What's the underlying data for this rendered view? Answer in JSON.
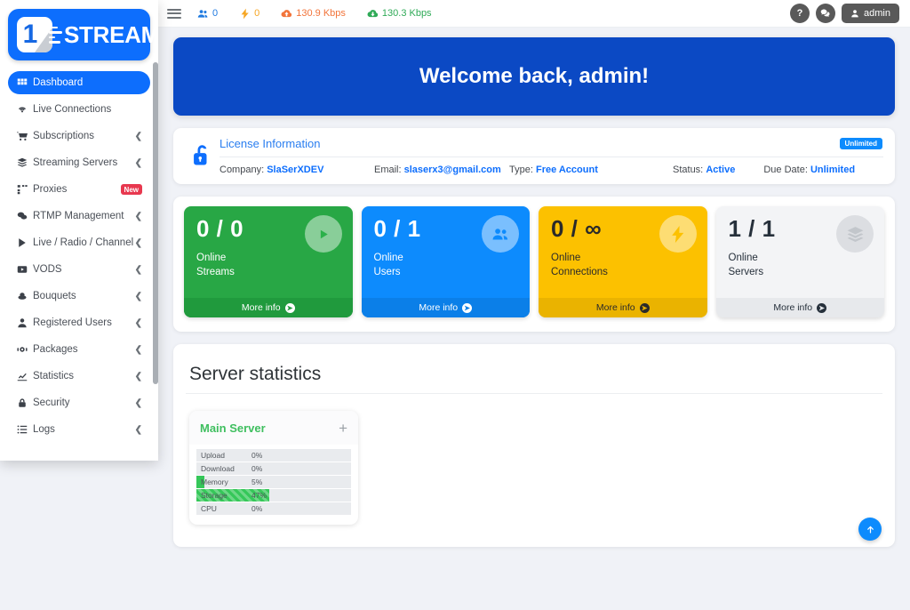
{
  "brand": {
    "logo_digit": "1",
    "logo_text": "STREAM"
  },
  "sidebar": {
    "items": [
      {
        "label": "Dashboard",
        "icon": "grid-icon",
        "active": true,
        "caret": false
      },
      {
        "label": "Live Connections",
        "icon": "wifi-icon",
        "active": false,
        "caret": false
      },
      {
        "label": "Subscriptions",
        "icon": "cart-icon",
        "active": false,
        "caret": true
      },
      {
        "label": "Streaming Servers",
        "icon": "servers-icon",
        "active": false,
        "caret": true
      },
      {
        "label": "Proxies",
        "icon": "sitemap-icon",
        "active": false,
        "caret": false,
        "badge": "New"
      },
      {
        "label": "RTMP Management",
        "icon": "comments-icon",
        "active": false,
        "caret": true
      },
      {
        "label": "Live / Radio / Channel",
        "icon": "play-icon",
        "active": false,
        "caret": true
      },
      {
        "label": "VODS",
        "icon": "video-icon",
        "active": false,
        "caret": true
      },
      {
        "label": "Bouquets",
        "icon": "flower-icon",
        "active": false,
        "caret": true
      },
      {
        "label": "Registered Users",
        "icon": "user-icon",
        "active": false,
        "caret": true
      },
      {
        "label": "Packages",
        "icon": "package-icon",
        "active": false,
        "caret": true
      },
      {
        "label": "Statistics",
        "icon": "chart-icon",
        "active": false,
        "caret": true
      },
      {
        "label": "Security",
        "icon": "lock-icon",
        "active": false,
        "caret": true
      },
      {
        "label": "Logs",
        "icon": "list-icon",
        "active": false,
        "caret": true
      }
    ]
  },
  "header": {
    "menu_toggle": "hamburger-icon",
    "stats": [
      {
        "icon": "users-icon",
        "value": "0",
        "color": "#1f7ae0"
      },
      {
        "icon": "bolt-icon",
        "value": "0",
        "color": "#f6a623"
      },
      {
        "icon": "cloud-upload-icon",
        "value": "130.9 Kbps",
        "color": "#f2743a"
      },
      {
        "icon": "cloud-download-icon",
        "value": "130.3 Kbps",
        "color": "#2faa57"
      }
    ],
    "help_label": "?",
    "chat_label": "chat-icon",
    "user_label": "admin"
  },
  "welcome": {
    "title": "Welcome back, admin!",
    "color": "#0b49c4"
  },
  "license": {
    "title": "License Information",
    "badge": "Unlimited",
    "fields": [
      {
        "label": "Company:",
        "value": "SlaSerXDEV"
      },
      {
        "label": "Email:",
        "value": "slaserx3@gmail.com"
      },
      {
        "label": "Type:",
        "value": "Free Account"
      },
      {
        "label": "Status:",
        "value": "Active"
      },
      {
        "label": "Due Date:",
        "value": "Unlimited"
      }
    ]
  },
  "cards": [
    {
      "value": "0 / 0",
      "line1": "Online",
      "line2": "Streams",
      "footer": "More info",
      "icon": "play-circle-icon",
      "variant": "c-green"
    },
    {
      "value": "0 / 1",
      "line1": "Online",
      "line2": "Users",
      "footer": "More info",
      "icon": "users-group-icon",
      "variant": "c-blue"
    },
    {
      "value": "0 / ∞",
      "line1": "Online",
      "line2": "Connections",
      "footer": "More info",
      "icon": "bolt-icon",
      "variant": "c-yellow"
    },
    {
      "value": "1 / 1",
      "line1": "Online",
      "line2": "Servers",
      "footer": "More info",
      "icon": "layers-icon",
      "variant": "c-grey"
    }
  ],
  "stats_section": {
    "title": "Server statistics",
    "server": {
      "name": "Main Server",
      "expand": "+",
      "metrics": [
        {
          "label": "Upload",
          "value": "0%",
          "percent": 0
        },
        {
          "label": "Download",
          "value": "0%",
          "percent": 0
        },
        {
          "label": "Memory",
          "value": "5%",
          "percent": 5
        },
        {
          "label": "Storage",
          "value": "47%",
          "percent": 47,
          "striped": true
        },
        {
          "label": "CPU",
          "value": "0%",
          "percent": 0
        }
      ]
    }
  },
  "to_top": {
    "icon": "arrow-up-icon"
  }
}
